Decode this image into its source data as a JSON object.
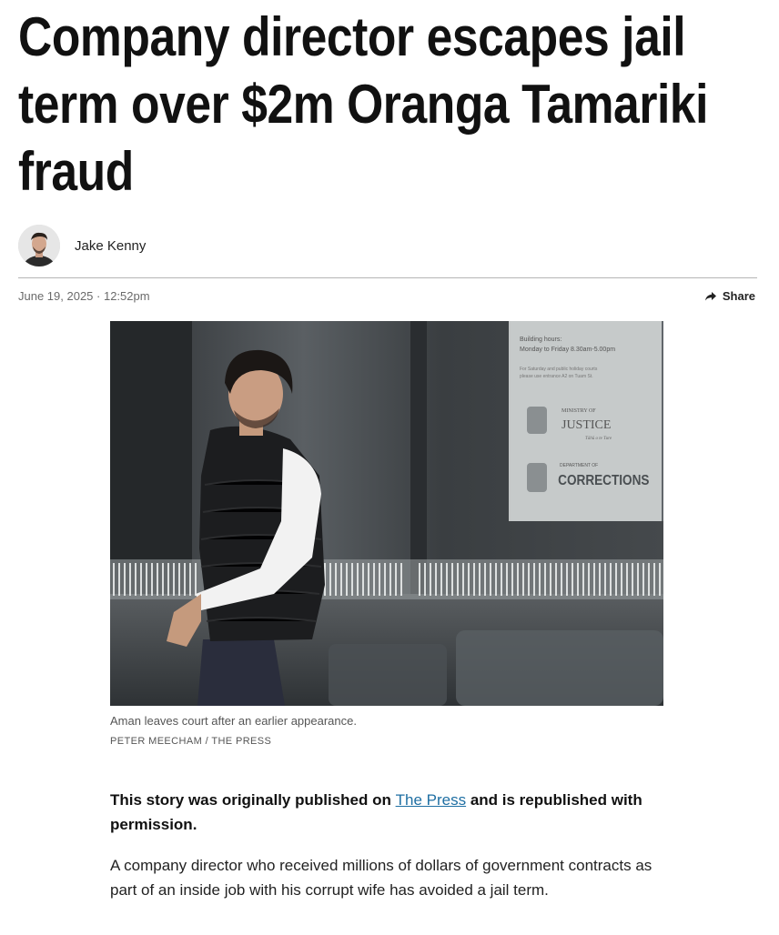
{
  "article": {
    "headline": "Company director escapes jail term over $2m Oranga Tamariki fraud",
    "author": "Jake Kenny",
    "date": "June 19, 2025 · 12:52pm",
    "share_label": "Share",
    "image_caption": "Aman leaves court after an earlier appearance.",
    "image_credit": "PETER MEECHAM / THE PRESS",
    "sign_text": {
      "hours_title": "Building hours:",
      "hours_detail": "Monday to Friday 8.30am-5.00pm",
      "saturday_note_1": "For Saturday and public holiday courts",
      "saturday_note_2": "please use entrance A2 on Tuam St.",
      "ministry_small": "MINISTRY OF",
      "ministry_big": "JUSTICE",
      "ministry_maori": "Tāhū o te Ture",
      "corrections_small": "DEPARTMENT OF",
      "corrections_big": "CORRECTIONS"
    },
    "lead_prefix": "This story was originally published on ",
    "lead_link": "The Press",
    "lead_suffix": " and is republished with permission.",
    "paragraph_1": "A company director who received millions of dollars of government contracts as part of an inside job with his corrupt wife has avoided a jail term."
  },
  "colors": {
    "link": "#1f6fa3",
    "divider": "#b5b5b5",
    "meta_text": "#6a6a6a"
  },
  "icons": {
    "share": "share-arrow-icon"
  }
}
